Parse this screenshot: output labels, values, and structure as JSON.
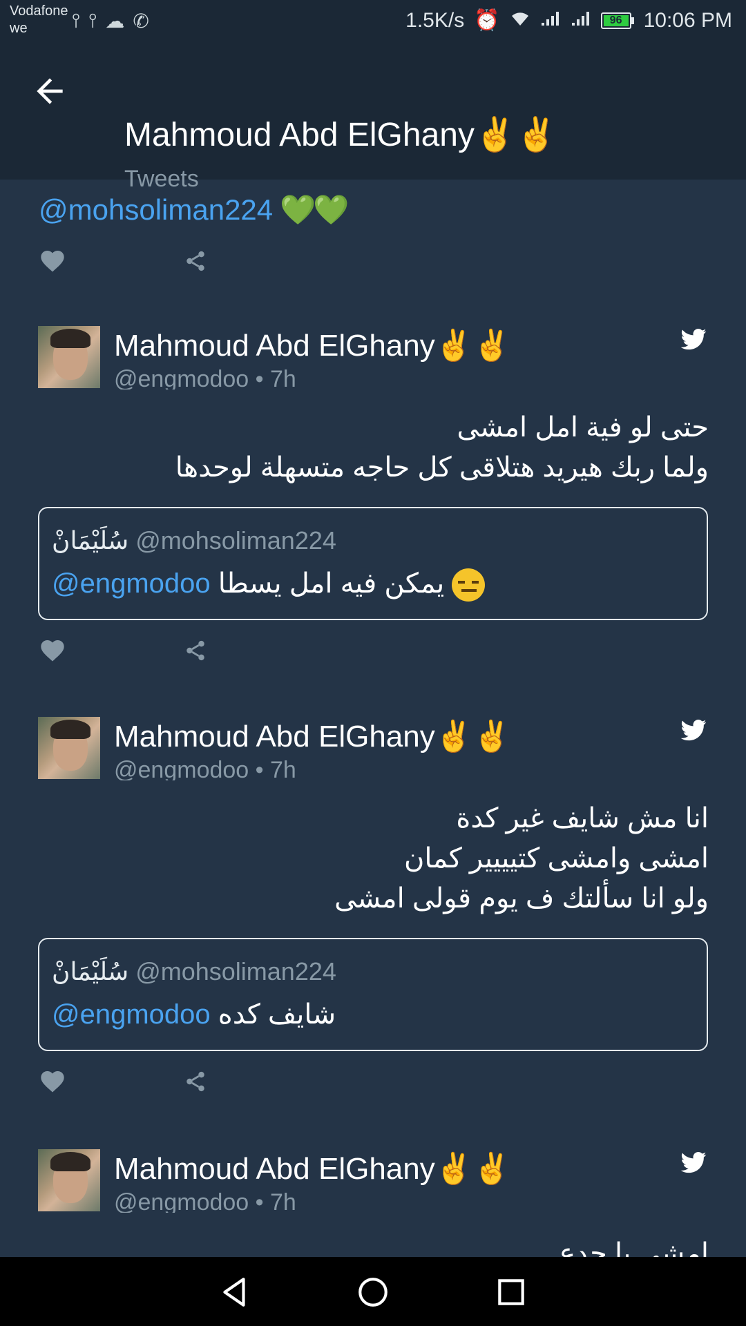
{
  "status_bar": {
    "carrier_line1": "Vodafone",
    "carrier_line2": "we",
    "net_speed": "1.5K/s",
    "battery": "96",
    "time": "10:06 PM"
  },
  "app_bar": {
    "title": "Mahmoud Abd ElGhany✌️✌️",
    "subtitle": "Tweets"
  },
  "feed": {
    "top_mention": "@mohsoliman224",
    "top_hearts": "💚💚",
    "tweets": [
      {
        "name": "Mahmoud Abd ElGhany✌️✌️",
        "handle": "@engmodoo • 7h",
        "lines": [
          "حتى لو فية امل امشى",
          "ولما ربك هيريد هتلاقى كل حاجه متسهلة لوحدها"
        ],
        "quote": {
          "author": "سُلَيْمَانْ",
          "handle": "@mohsoliman224",
          "mention": "@engmodoo",
          "text": "يمكن فيه امل يسطا"
        }
      },
      {
        "name": "Mahmoud Abd ElGhany✌️✌️",
        "handle": "@engmodoo • 7h",
        "lines": [
          "انا مش شايف غير كدة",
          "امشى وامشى كتيييير كمان",
          "ولو انا سألتك ف يوم قولى امشى"
        ],
        "quote": {
          "author": "سُلَيْمَانْ",
          "handle": "@mohsoliman224",
          "mention": "@engmodoo",
          "text": "شايف كده"
        }
      },
      {
        "name": "Mahmoud Abd ElGhany✌️✌️",
        "handle": "@engmodoo • 7h",
        "lines": [
          "امشى يا جدع"
        ]
      }
    ]
  },
  "colors": {
    "background": "#243447",
    "bar": "#1b2836",
    "accent": "#4aa3f0",
    "muted": "#8899a6"
  }
}
